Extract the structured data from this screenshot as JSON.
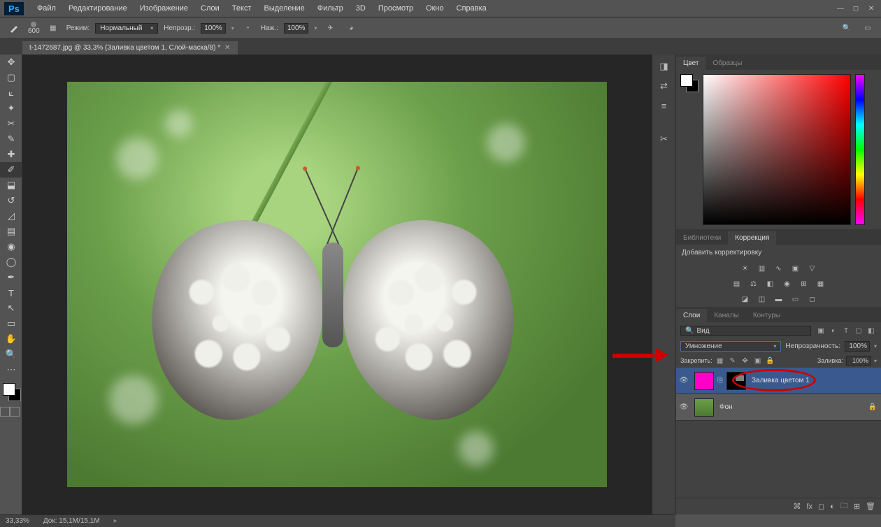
{
  "menubar": {
    "logo": "Ps",
    "items": [
      "Файл",
      "Редактирование",
      "Изображение",
      "Слои",
      "Текст",
      "Выделение",
      "Фильтр",
      "3D",
      "Просмотр",
      "Окно",
      "Справка"
    ]
  },
  "optbar": {
    "brush_size": "600",
    "mode_label": "Режим:",
    "mode_value": "Нормальный",
    "opacity_label": "Непрозр.:",
    "opacity_value": "100%",
    "flow_label": "Наж.:",
    "flow_value": "100%"
  },
  "doc_tab": {
    "title": "t-1472687.jpg @ 33,3% (Заливка цветом 1, Слой-маска/8) *"
  },
  "panels": {
    "color_tab": "Цвет",
    "swatches_tab": "Образцы",
    "lib_tab": "Библиотеки",
    "adj_tab": "Коррекция",
    "adj_label": "Добавить корректировку",
    "layers_tab": "Слои",
    "channels_tab": "Каналы",
    "paths_tab": "Контуры",
    "kind_label": "Вид",
    "blend_mode": "Умножение",
    "opacity_label": "Непрозрачность:",
    "opacity_value": "100%",
    "lock_label": "Закрепить:",
    "fill_label": "Заливка:",
    "fill_value": "100%",
    "layer1_name": "Заливка цветом 1",
    "layer2_name": "Фон"
  },
  "statusbar": {
    "zoom": "33,33%",
    "doc_size": "Док: 15,1M/15,1M"
  }
}
